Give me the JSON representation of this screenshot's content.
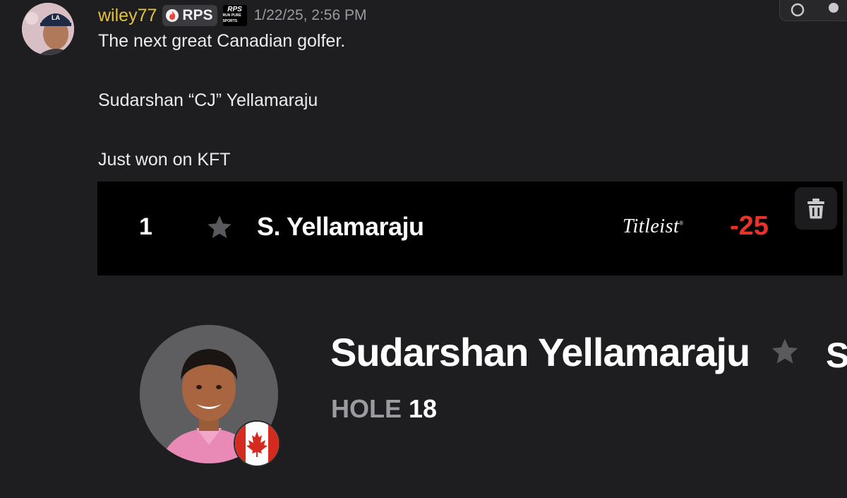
{
  "message": {
    "username": "wiley77",
    "role_badge": "RPS",
    "rps_logo": {
      "line1": "RPS",
      "line2": "RUN PURE SPORTS"
    },
    "timestamp": "1/22/25, 2:56 PM",
    "lines": [
      "The next great Canadian golfer.",
      "Sudarshan “CJ” Yellamaraju",
      "Just won on KFT"
    ]
  },
  "leaderboard": {
    "position": "1",
    "player": "S. Yellamaraju",
    "sponsor": "Titleist",
    "score": "-25"
  },
  "profile": {
    "full_name": "Sudarshan Yellamaraju",
    "hole_label": "HOLE",
    "hole_number": "18",
    "truncated_glyph": "S"
  },
  "icons": {
    "favorite": "star-icon",
    "delete": "trash-icon",
    "country": "canada-flag-icon",
    "role": "fire-icon"
  },
  "colors": {
    "username": "#e3c23a",
    "score": "#e8332a",
    "background": "#1e1e20"
  }
}
